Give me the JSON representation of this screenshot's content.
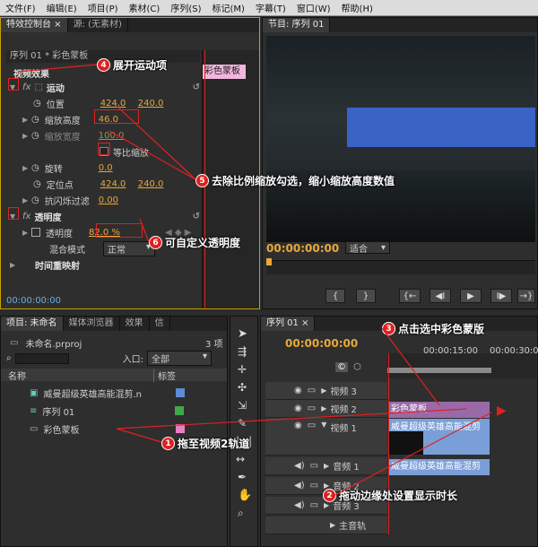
{
  "menubar": [
    "文件(F)",
    "编辑(E)",
    "项目(P)",
    "素材(C)",
    "序列(S)",
    "标记(M)",
    "字幕(T)",
    "窗口(W)",
    "帮助(H)"
  ],
  "effect_panel": {
    "tab_active": "特效控制台",
    "tab_source": "源: (无素材)",
    "sequence_label": "序列 01 * 彩色蒙板",
    "clip_label": "彩色蒙板",
    "section": "视频效果",
    "motion": "运动",
    "position_label": "位置",
    "position_x": "424.0",
    "position_y": "240.0",
    "scale_h_label": "缩放高度",
    "scale_h": "46.0",
    "scale_w_label": "缩放宽度",
    "scale_w": "100.0",
    "uniform_label": "等比缩放",
    "rotation_label": "旋转",
    "rotation": "0.0",
    "anchor_label": "定位点",
    "anchor_x": "424.0",
    "anchor_y": "240.0",
    "flicker_label": "抗闪烁过滤",
    "flicker": "0.00",
    "opacity_section": "透明度",
    "opacity_label": "透明度",
    "opacity": "82.0 %",
    "blend_label": "混合模式",
    "blend_value": "正常",
    "time_remap": "时间重映射",
    "timecode": "00:00:00:00"
  },
  "program_panel": {
    "tab": "节目: 序列 01",
    "timecode": "00:00:00:00",
    "fit_label": "适合"
  },
  "project_panel": {
    "tab": "项目: 未命名",
    "tab2": "媒体浏览器",
    "tab3": "效果",
    "tab4": "信",
    "file": "未命名.prproj",
    "count": "3 项",
    "entry_label": "入口:",
    "entry_value": "全部",
    "col_name": "名称",
    "col_label": "标签",
    "items": [
      {
        "name": "威曼超级英雄高能混剪.n",
        "color": "#5b8dd6"
      },
      {
        "name": "序列 01",
        "color": "#3fa84b"
      },
      {
        "name": "彩色蒙板",
        "color": "#e97ec4"
      }
    ]
  },
  "timeline": {
    "tab": "序列 01",
    "timecode": "00:00:00:00",
    "ruler_time": "00:00:15:00",
    "ruler_time2": "00:00:30:00",
    "tracks": [
      "视频 3",
      "视频 2",
      "视频 1",
      "音频 1",
      "音频 2",
      "音频 3",
      "主音轨"
    ],
    "clip_matte": "彩色蒙板",
    "clip_video": "威曼超级英雄高能混剪",
    "clip_audio": "威曼超级英雄高能混剪"
  },
  "callouts": {
    "c1": "拖至视频2轨道",
    "c2": "拖动边缘处设置显示时长",
    "c3": "点击选中彩色蒙版",
    "c4": "展开运动项",
    "c5": "去除比例缩放勾选，缩小缩放高度数值",
    "c6": "可自定义透明度"
  }
}
